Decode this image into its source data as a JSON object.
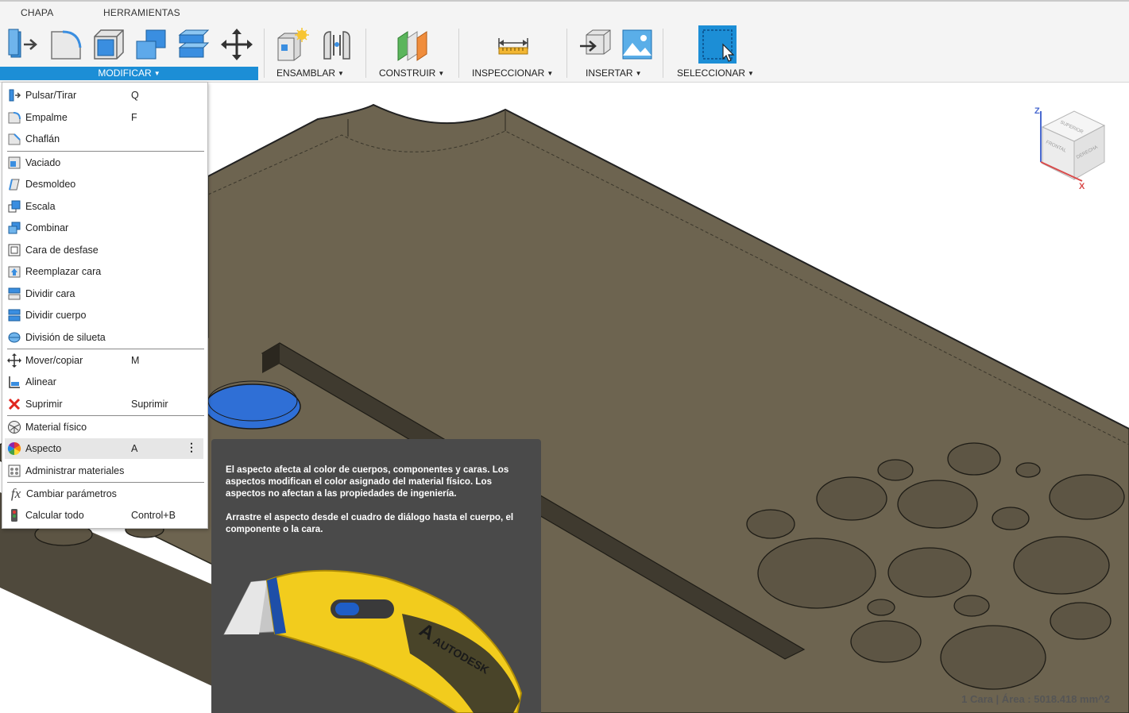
{
  "toolbar": {
    "tabs": [
      "CHAPA",
      "HERRAMIENTAS"
    ],
    "groups": {
      "modificar": "MODIFICAR",
      "ensamblar": "ENSAMBLAR",
      "construir": "CONSTRUIR",
      "inspeccionar": "INSPECCIONAR",
      "insertar": "INSERTAR",
      "seleccionar": "SELECCIONAR"
    }
  },
  "menu": {
    "items": [
      {
        "label": "Pulsar/Tirar",
        "shortcut": "Q",
        "icon": "push-pull-icon"
      },
      {
        "label": "Empalme",
        "shortcut": "F",
        "icon": "fillet-icon"
      },
      {
        "label": "Chaflán",
        "shortcut": "",
        "icon": "chamfer-icon"
      },
      {
        "label": "Vaciado",
        "shortcut": "",
        "icon": "shell-icon"
      },
      {
        "label": "Desmoldeo",
        "shortcut": "",
        "icon": "draft-icon"
      },
      {
        "label": "Escala",
        "shortcut": "",
        "icon": "scale-icon"
      },
      {
        "label": "Combinar",
        "shortcut": "",
        "icon": "combine-icon"
      },
      {
        "label": "Cara de desfase",
        "shortcut": "",
        "icon": "offset-face-icon"
      },
      {
        "label": "Reemplazar cara",
        "shortcut": "",
        "icon": "replace-face-icon"
      },
      {
        "label": "Dividir cara",
        "shortcut": "",
        "icon": "split-face-icon"
      },
      {
        "label": "Dividir cuerpo",
        "shortcut": "",
        "icon": "split-body-icon"
      },
      {
        "label": "División de silueta",
        "shortcut": "",
        "icon": "silhouette-split-icon"
      },
      {
        "label": "Mover/copiar",
        "shortcut": "M",
        "icon": "move-icon"
      },
      {
        "label": "Alinear",
        "shortcut": "",
        "icon": "align-icon"
      },
      {
        "label": "Suprimir",
        "shortcut": "Suprimir",
        "icon": "delete-x-icon"
      },
      {
        "label": "Material físico",
        "shortcut": "",
        "icon": "physical-material-icon"
      },
      {
        "label": "Aspecto",
        "shortcut": "A",
        "icon": "appearance-icon"
      },
      {
        "label": "Administrar materiales",
        "shortcut": "",
        "icon": "manage-materials-icon"
      },
      {
        "label": "Cambiar parámetros",
        "shortcut": "",
        "icon": "fx-icon"
      },
      {
        "label": "Calcular todo",
        "shortcut": "Control+B",
        "icon": "compute-all-icon"
      }
    ]
  },
  "tooltip": {
    "paragraph1": "El aspecto afecta al color de cuerpos, componentes y caras. Los aspectos modifican el color asignado del material físico. Los aspectos no afectan a las propiedades de ingeniería.",
    "paragraph2": "Arrastre el aspecto desde el cuadro de diálogo hasta el cuerpo, el componente o la cara.",
    "brand": "AUTODESK"
  },
  "viewcube": {
    "top": "SUPERIOR",
    "front": "FRONTAL",
    "right": "DERECHA",
    "axis_z": "Z",
    "axis_x": "X"
  },
  "status": "1 Cara | Área : 5018.418 mm^2",
  "colors": {
    "accent": "#1c8ed6",
    "model_top": "#6d6450",
    "model_side": "#4d473a",
    "selected_face": "#2f6fd6",
    "tooltip_bg": "#4a4a4a"
  }
}
